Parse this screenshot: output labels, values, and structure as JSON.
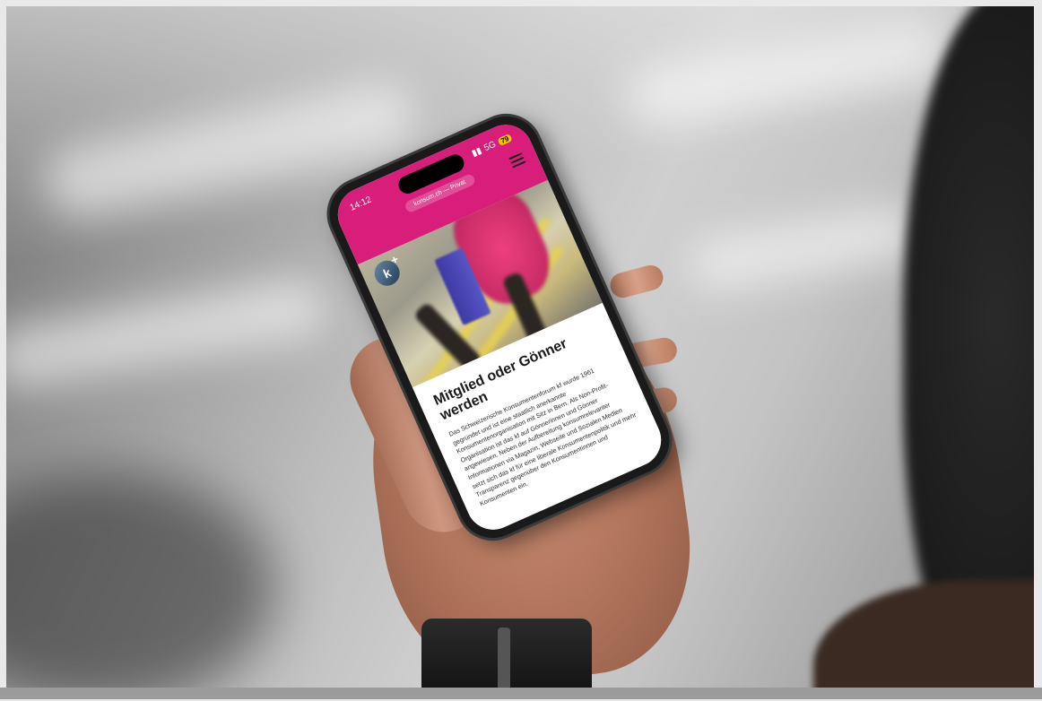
{
  "phone": {
    "status": {
      "time": "14:12",
      "network": "5G",
      "battery": "79"
    },
    "url": "konsum.ch — Privat",
    "logo_letter": "k",
    "logo_plus": "+",
    "article": {
      "headline": "Mitglied oder Gönner werden",
      "body": "Das Schweizerische Konsumentenforum kf wurde 1961 gegründet und ist eine staatlich anerkannte Konsumentenorganisation mit Sitz in Bern. Als Non-Profit-Organisation ist das kf auf Gönnerinnen und Gönner angewiesen. Neben der Aufbereitung konsumrelevanter Informationen via Magazin, Webseite und Sozialen Medien setzt sich das kf für eine liberale Konsumentenpolitik und mehr Transparenz gegenüber den Konsumentinnen und Konsumenten ein."
    }
  },
  "icons": [
    "signal-icon",
    "menu-icon",
    "logo-icon"
  ],
  "colors": {
    "brand": "#d81e7a",
    "battery": "#f5c400"
  }
}
